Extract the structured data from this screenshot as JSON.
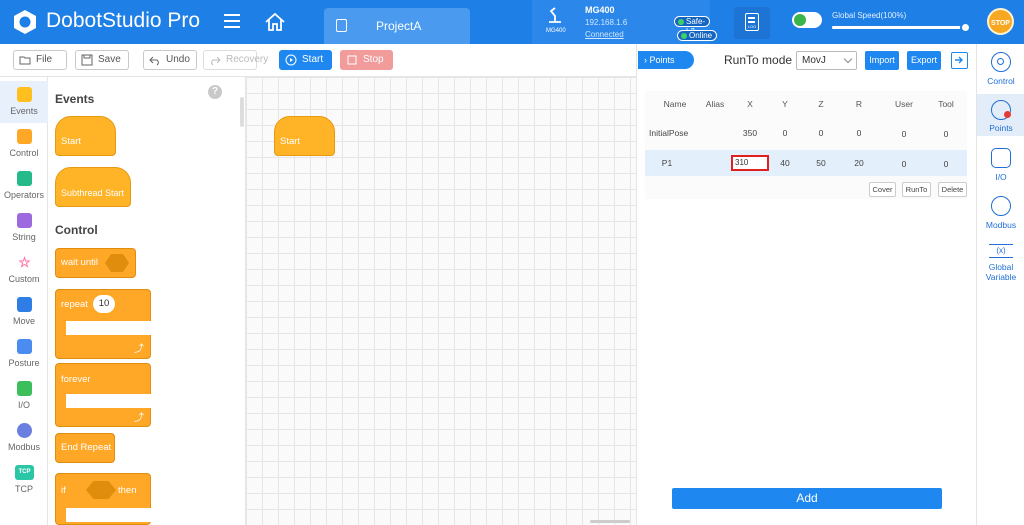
{
  "header": {
    "app_title": "DobotStudio Pro",
    "project_tab": "ProjectA",
    "robot": {
      "model": "MG400",
      "model_small": "MG400",
      "ip": "192.168.1.6",
      "connection": "Connected",
      "safety": "Safe-L3",
      "status": "Online"
    },
    "log_icon_label": "LOG",
    "global_speed_label": "Global Speed(100%)",
    "global_speed_value": 100,
    "stop_label": "STOP"
  },
  "toolbar": {
    "file": "File",
    "save": "Save",
    "undo": "Undo",
    "recovery": "Recovery",
    "start": "Start",
    "stop": "Stop"
  },
  "categories": [
    {
      "label": "Events",
      "color": "#ffbf1f",
      "icon": "events-icon"
    },
    {
      "label": "Control",
      "color": "#ffa726",
      "icon": "control-icon"
    },
    {
      "label": "Operators",
      "color": "#26b98a",
      "icon": "operators-icon"
    },
    {
      "label": "String",
      "color": "#9c6ade",
      "icon": "string-icon"
    },
    {
      "label": "Custom",
      "color": "#ff6fa8",
      "icon": "custom-icon"
    },
    {
      "label": "Move",
      "color": "#2f7ee6",
      "icon": "move-icon"
    },
    {
      "label": "Posture",
      "color": "#4a8cf0",
      "icon": "posture-icon"
    },
    {
      "label": "I/O",
      "color": "#3cbf5a",
      "icon": "io-icon"
    },
    {
      "label": "Modbus",
      "color": "#6b7fe0",
      "icon": "modbus-icon"
    },
    {
      "label": "TCP",
      "color": "#2bc6a6",
      "icon": "tcp-icon"
    }
  ],
  "palette": {
    "events_heading": "Events",
    "control_heading": "Control",
    "start_block": "Start",
    "subthread_block": "Subthread Start",
    "wait_until": "wait until",
    "repeat": "repeat",
    "repeat_count": "10",
    "forever": "forever",
    "end_repeat": "End Repeat",
    "if": "if",
    "then": "then",
    "help": "?"
  },
  "canvas": {
    "start_block": "Start"
  },
  "points_panel": {
    "tab_label": "Points",
    "runto_label": "RunTo mode",
    "runto_value": "MovJ",
    "import": "Import",
    "export": "Export",
    "columns": [
      "Name",
      "Alias",
      "X",
      "Y",
      "Z",
      "R",
      "User",
      "Tool"
    ],
    "rows": [
      {
        "name": "InitialPose",
        "alias": "",
        "x": "350",
        "y": "0",
        "z": "0",
        "r": "0",
        "user": "0",
        "tool": "0"
      },
      {
        "name": "P1",
        "alias": "",
        "x": "310",
        "y": "40",
        "z": "50",
        "r": "20",
        "user": "0",
        "tool": "0"
      }
    ],
    "cover": "Cover",
    "runto": "RunTo",
    "delete": "Delete",
    "add": "Add"
  },
  "right_sidebar": [
    {
      "label": "Control"
    },
    {
      "label": "Points"
    },
    {
      "label": "I/O"
    },
    {
      "label": "Modbus"
    },
    {
      "label": "Global Variable",
      "symbol": "(x)"
    }
  ]
}
